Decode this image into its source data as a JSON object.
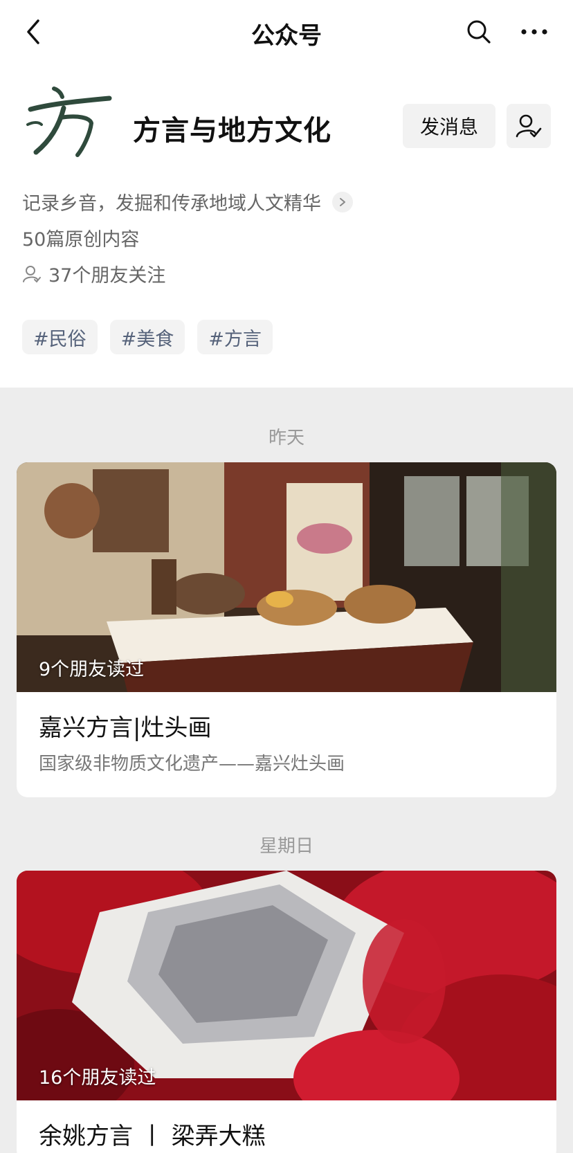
{
  "nav": {
    "title": "公众号",
    "back_icon": "chevron-left-icon",
    "search_icon": "search-icon",
    "more_icon": "more-dots-icon"
  },
  "account": {
    "name": "方言与地方文化",
    "logo_icon": "calligraphy-fang-logo",
    "message_button": "发消息",
    "follow_icon": "user-check-icon",
    "description": "记录乡音，发掘和传承地域人文精华",
    "original_count": "50篇原创内容",
    "friends_following": "37个朋友关注",
    "tags": [
      "#民俗",
      "#美食",
      "#方言"
    ]
  },
  "colors": {
    "page_bg": "#ededed",
    "tag_text": "#55627a",
    "logo_ink": "#2f4a3c"
  },
  "feed": [
    {
      "date": "昨天",
      "read_by": "9个朋友读过",
      "title": "嘉兴方言|灶头画",
      "subtitle": "国家级非物质文化遗产——嘉兴灶头画"
    },
    {
      "date": "星期日",
      "read_by": "16个朋友读过",
      "title": "余姚方言 丨 梁弄大糕"
    }
  ]
}
